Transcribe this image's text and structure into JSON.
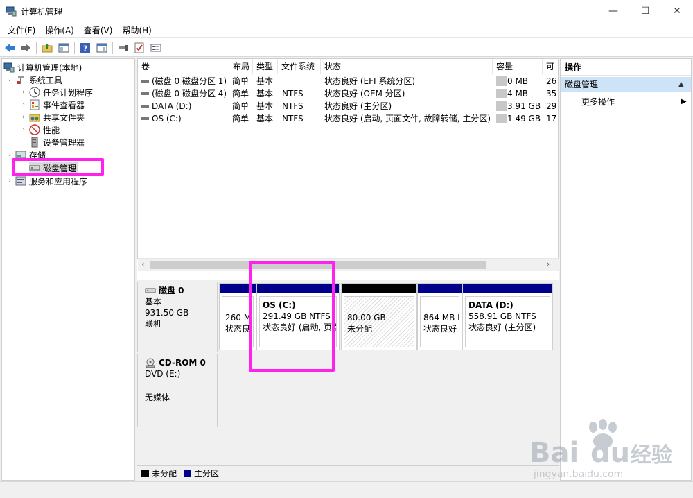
{
  "window": {
    "title": "计算机管理"
  },
  "window_controls": {
    "minimize": "—",
    "maximize": "☐",
    "close": "✕"
  },
  "menu": [
    "文件(F)",
    "操作(A)",
    "查看(V)",
    "帮助(H)"
  ],
  "tree": {
    "root": "计算机管理(本地)",
    "system_tools": "系统工具",
    "task_scheduler": "任务计划程序",
    "event_viewer": "事件查看器",
    "shared_folders": "共享文件夹",
    "performance": "性能",
    "device_manager": "设备管理器",
    "storage": "存储",
    "disk_management": "磁盘管理",
    "services_apps": "服务和应用程序"
  },
  "columns": [
    "卷",
    "布局",
    "类型",
    "文件系统",
    "状态",
    "容量",
    "可"
  ],
  "volumes": [
    {
      "volume": "(磁盘 0 磁盘分区 1)",
      "layout": "简单",
      "type": "基本",
      "fs": "",
      "status": "状态良好 (EFI 系统分区)",
      "capacity": "0 MB",
      "free": "26"
    },
    {
      "volume": "(磁盘 0 磁盘分区 4)",
      "layout": "简单",
      "type": "基本",
      "fs": "NTFS",
      "status": "状态良好 (OEM 分区)",
      "capacity": "4 MB",
      "free": "35"
    },
    {
      "volume": "DATA (D:)",
      "layout": "简单",
      "type": "基本",
      "fs": "NTFS",
      "status": "状态良好 (主分区)",
      "capacity": "3.91 GB",
      "free": "29"
    },
    {
      "volume": "OS (C:)",
      "layout": "简单",
      "type": "基本",
      "fs": "NTFS",
      "status": "状态良好 (启动, 页面文件, 故障转储, 主分区)",
      "capacity": "1.49 GB",
      "free": "17"
    }
  ],
  "disk0": {
    "name": "磁盘 0",
    "type": "基本",
    "size": "931.50 GB",
    "state": "联机",
    "partitions": {
      "p1": {
        "size": "260 M",
        "status": "状态良"
      },
      "os": {
        "name": "OS  (C:)",
        "size": "291.49 GB NTFS",
        "status": "状态良好 (启动, 页面"
      },
      "unalloc": {
        "size": "80.00 GB",
        "status": "未分配"
      },
      "p4": {
        "size": "864 MB I",
        "status": "状态良好"
      },
      "data": {
        "name": "DATA  (D:)",
        "size": "558.91 GB NTFS",
        "status": "状态良好 (主分区)"
      }
    }
  },
  "cdrom": {
    "name": "CD-ROM 0",
    "drive": "DVD (E:)",
    "media": "无媒体"
  },
  "legend": {
    "unallocated": "未分配",
    "primary": "主分区"
  },
  "actions": {
    "header": "操作",
    "section": "磁盘管理",
    "more": "更多操作"
  },
  "watermark": {
    "brand": "Bai",
    "brand2": "du",
    "cn": "经验",
    "url": "jingyan.baidu.com"
  },
  "colors": {
    "primary": "#00008b",
    "unallocated": "#000000",
    "highlight": "#ff22ee",
    "selection": "#cde3f7"
  }
}
